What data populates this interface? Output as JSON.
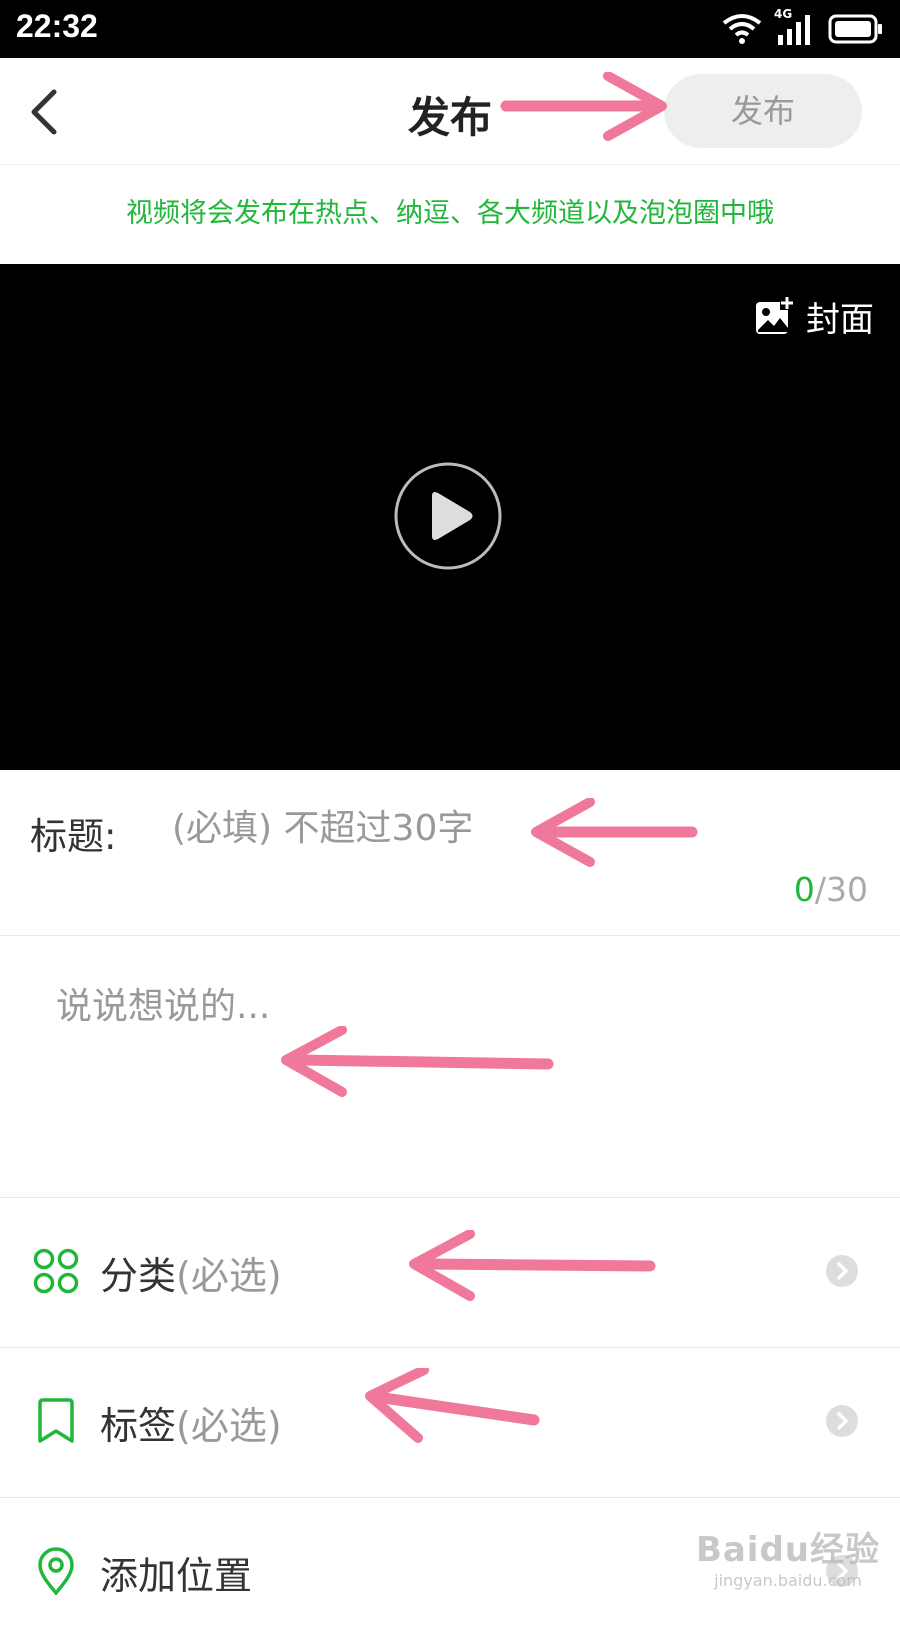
{
  "status_bar": {
    "time": "22:32",
    "network": "4G"
  },
  "nav": {
    "title": "发布",
    "publish_label": "发布"
  },
  "notice": "视频将会发布在热点、纳逗、各大频道以及泡泡圈中哦",
  "video": {
    "cover_label": "封面"
  },
  "title_field": {
    "label": "标题:",
    "placeholder": "(必填) 不超过30字",
    "count": "0",
    "max": "/30"
  },
  "description": {
    "placeholder": "说说想说的..."
  },
  "options": [
    {
      "label": "分类",
      "hint": "(必选)",
      "icon": "category-icon"
    },
    {
      "label": "标签",
      "hint": "(必选)",
      "icon": "tag-icon"
    },
    {
      "label": "添加位置",
      "hint": "",
      "icon": "location-icon"
    }
  ],
  "watermark": {
    "logo": "Baidu经验",
    "url": "jingyan.baidu.com"
  },
  "colors": {
    "accent": "#20b73a",
    "annotation_arrow": "#f0789a",
    "video_bg": "#000000"
  }
}
